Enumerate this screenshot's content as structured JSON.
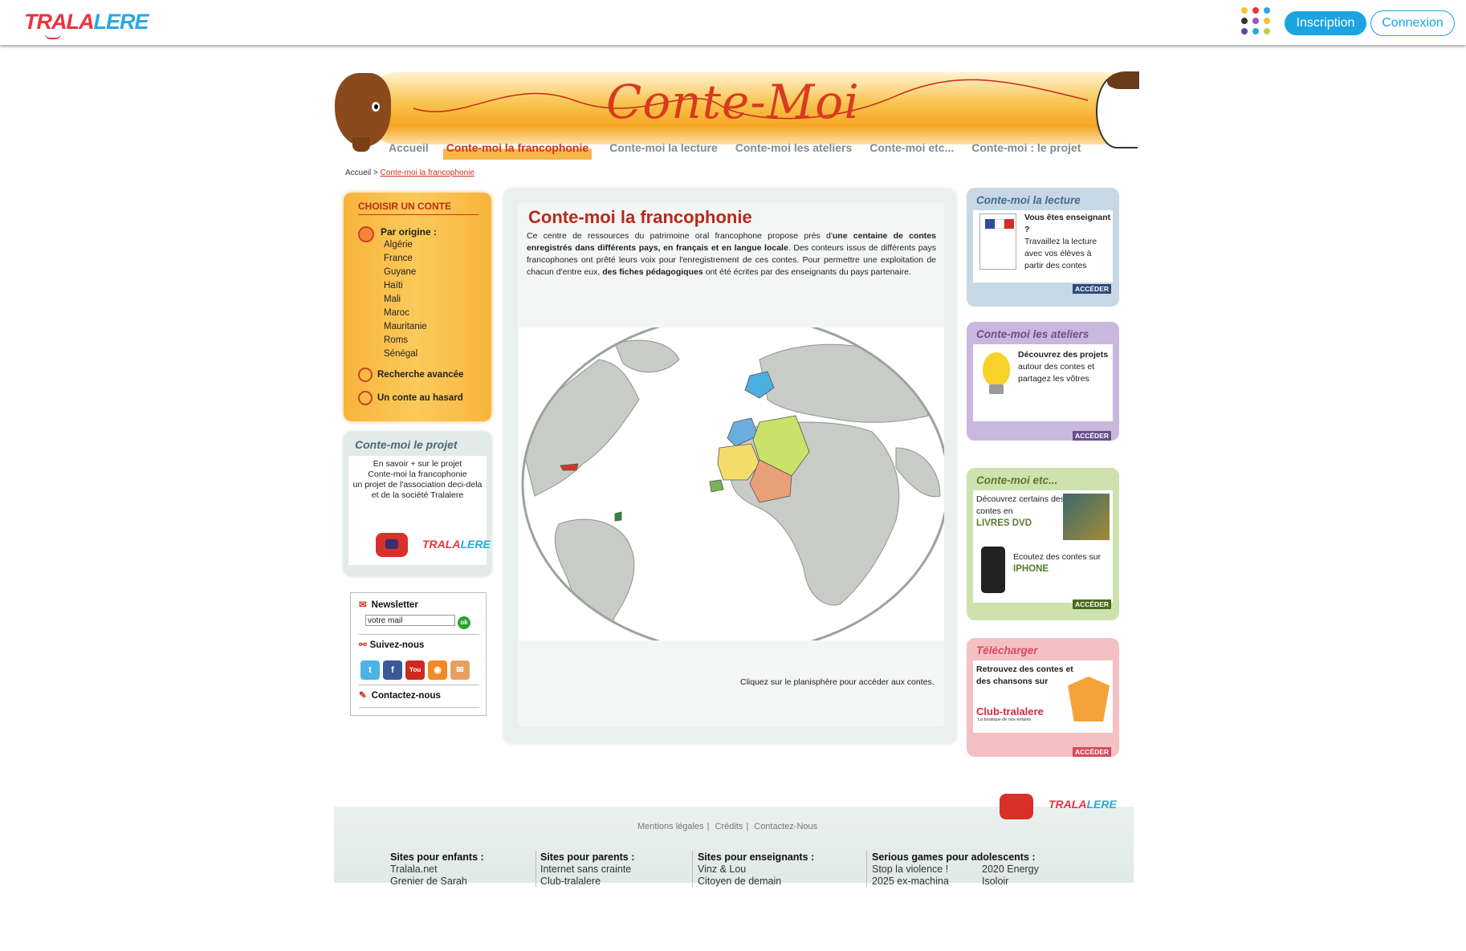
{
  "topbar": {
    "logo_part1": "TRALA",
    "logo_part2": "LERE",
    "apps_icon": "apps-grid-icon",
    "inscription": "Inscription",
    "connexion": "Connexion"
  },
  "banner": {
    "title": "Conte-Moi"
  },
  "nav": [
    "Accueil",
    "Conte-moi la francophonie",
    "Conte-moi la lecture",
    "Conte-moi les ateliers",
    "Conte-moi etc...",
    "Conte-moi : le projet"
  ],
  "breadcrumb": {
    "home": "Accueil",
    "sep": ">",
    "current": "Conte-moi la francophonie"
  },
  "left": {
    "choisir": {
      "heading": "CHOISIR UN CONTE",
      "origin_label": "Par origine :",
      "origins": [
        "Algérie",
        "France",
        "Guyane",
        "Haïti",
        "Mali",
        "Maroc",
        "Mauritanie",
        "Roms",
        "Sénégal"
      ],
      "advanced": "Recherche avancée",
      "random": "Un conte au hasard"
    },
    "projet": {
      "heading": "Conte-moi le projet",
      "line1": "En savoir + sur le projet",
      "line2": "Conte-moi la francophonie",
      "line3": "un projet de l'association deci-dela",
      "line4": "et de la société Tralalere"
    },
    "newsletter": {
      "label": "Newsletter",
      "input_value": "votre mail",
      "ok": "ok",
      "follow": "Suivez-nous",
      "contact": "Contactez-nous",
      "social": [
        "twitter-icon",
        "facebook-icon",
        "youtube-icon",
        "rss-icon",
        "email-icon"
      ]
    }
  },
  "main": {
    "title": "Conte-moi la francophonie",
    "p1": "Ce centre de ressources du patrimoine oral francophone propose près d'",
    "p1_bold": "une centaine de contes enregistrés dans différents pays, en français et en langue locale",
    "p2": ". Des conteurs issus de différents pays francophones ont prêté leurs voix pour l'enregistrement de ces contes. Pour permettre une exploitation de chacun d'entre eux, ",
    "p2_bold": "des fiches pédagogiques",
    "p3": " ont été écrites par des enseignants du pays partenaire.",
    "map_caption": "Cliquez sur le planisphère pour accéder aux contes."
  },
  "right": {
    "lecture": {
      "heading": "Conte-moi la lecture",
      "q": "Vous êtes enseignant ?",
      "text": "Travaillez la lecture avec vos élèves à partir des contes",
      "access": "ACCÉDER"
    },
    "ateliers": {
      "heading": "Conte-moi les ateliers",
      "bold": "Découvrez des projets",
      "text": "autour des contes et partagez les vôtres",
      "access": "ACCÉDER"
    },
    "etc": {
      "heading": "Conte-moi etc...",
      "t1": "Découvrez certains des contes en",
      "t1_bold": "LIVRES DVD",
      "t2": "Ecoutez des contes sur",
      "t2_bold": "IPHONE",
      "access": "ACCÉDER"
    },
    "tele": {
      "heading": "Télécharger",
      "text": "Retrouvez des contes et des chansons sur",
      "brand": "Club-tralalere",
      "brand_sub": "La boutique de nos enfants",
      "access": "ACCÉDER"
    }
  },
  "footer": {
    "links": [
      "Mentions légales",
      "Crédits",
      "Contactez-Nous"
    ],
    "col1": {
      "heading": "Sites pour enfants :",
      "items": [
        "Tralala.net",
        "Grenier de Sarah"
      ]
    },
    "col2": {
      "heading": "Sites pour parents :",
      "items": [
        "Internet sans crainte",
        "Club-tralalere"
      ]
    },
    "col3": {
      "heading": "Sites pour enseignants :",
      "items": [
        "Vinz & Lou",
        "Citoyen de demain"
      ]
    },
    "col4": {
      "heading": "Serious games pour adolescents :",
      "items_a": [
        "Stop la violence !",
        "2025 ex-machina"
      ],
      "items_b": [
        "2020 Energy",
        "Isoloir"
      ]
    }
  },
  "colors": {
    "accent_blue": "#1aa4e0",
    "brand_red": "#d0321e",
    "orange": "#f8b43c"
  }
}
